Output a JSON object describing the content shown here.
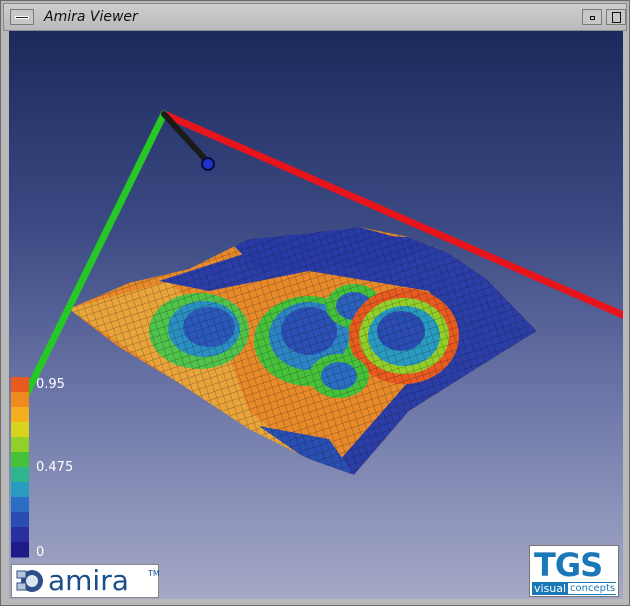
{
  "window": {
    "title": "Amira Viewer"
  },
  "legend": {
    "max_label": "0.95",
    "mid_label": "0.475",
    "min_label": "0",
    "colors": [
      "#e85a1f",
      "#ef8a1c",
      "#f2b01e",
      "#d8d41e",
      "#92cf2a",
      "#46c23a",
      "#2fb58e",
      "#2a9bc0",
      "#2c6ec4",
      "#2b4cb3",
      "#2a2f9e",
      "#1e1a86"
    ]
  },
  "logos": {
    "amira": "amira",
    "amira_tm": "TM",
    "tgs": "TGS",
    "tgs_visual": "visual",
    "tgs_concepts": "concepts"
  },
  "axes": {
    "x_color": "#e8141b",
    "y_color": "#26c826",
    "z_color": "#1a1a1a"
  }
}
